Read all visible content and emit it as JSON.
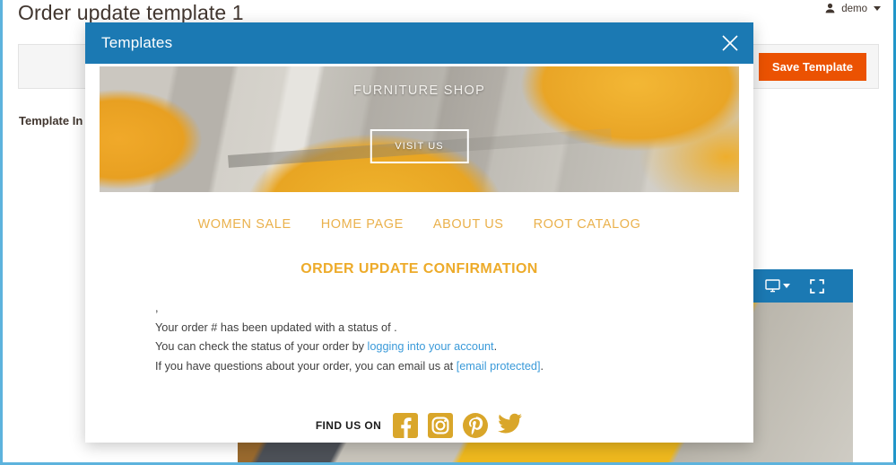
{
  "admin": {
    "page_title": "Order update template 1",
    "user_name": "demo",
    "user_icon": "user-icon",
    "caret_icon": "chevron-down-icon",
    "save_label": "Save Template",
    "section_label": "Template In"
  },
  "preview": {
    "toolbar_icons": [
      "trash-icon",
      "desktop-icon",
      "fullscreen-icon"
    ],
    "shop_text": "FURNITURE SHOP"
  },
  "modal": {
    "title": "Templates",
    "close_icon": "close-icon",
    "hero": {
      "title": "FURNITURE SHOP",
      "button_label": "VISIT US"
    },
    "nav": [
      {
        "label": "WOMEN SALE"
      },
      {
        "label": "HOME PAGE"
      },
      {
        "label": "ABOUT US"
      },
      {
        "label": "ROOT CATALOG"
      }
    ],
    "heading": "ORDER UPDATE CONFIRMATION",
    "body": {
      "greeting": ",",
      "line1": "Your order # has been updated with a status of .",
      "line2_pre": "You can check the status of your order by ",
      "line2_link": "logging into your account",
      "line2_post": ".",
      "line3_pre": "If you have questions about your order, you can email us at ",
      "line3_link": "[email protected]",
      "line3_post": "."
    },
    "footer": {
      "find_us_label": "FIND US ON",
      "socials": [
        {
          "name": "facebook-icon"
        },
        {
          "name": "instagram-icon"
        },
        {
          "name": "pinterest-icon"
        },
        {
          "name": "twitter-icon"
        }
      ]
    }
  },
  "colors": {
    "modal_header_blue": "#1b79b3",
    "save_orange": "#eb5202",
    "accent_gold": "#eab14c",
    "heading_gold": "#edab2a",
    "link_blue": "#3a9ad9",
    "social_gold": "#d9a62a",
    "page_border": "#5db3dd"
  }
}
